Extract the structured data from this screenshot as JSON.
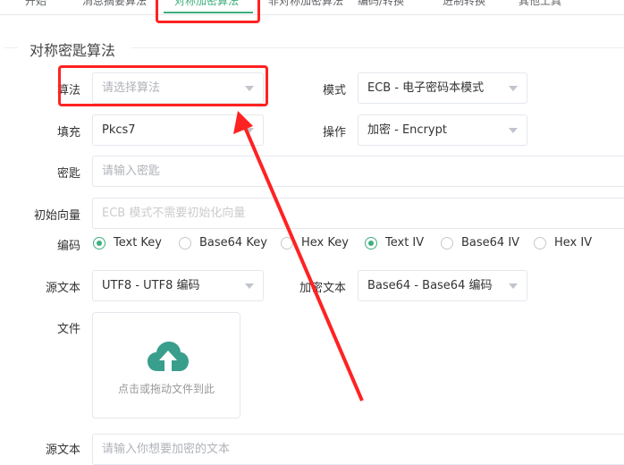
{
  "tabs": [
    {
      "label": "开始"
    },
    {
      "label": "消息摘要算法"
    },
    {
      "label": "对称加密算法",
      "active": true
    },
    {
      "label": "非对称加密算法"
    },
    {
      "label": "编码/转换"
    },
    {
      "label": "进制转换"
    },
    {
      "label": "其他工具"
    }
  ],
  "section_title": "对称密匙算法",
  "form": {
    "algorithm": {
      "label": "算法",
      "placeholder": "请选择算法"
    },
    "mode": {
      "label": "模式",
      "value": "ECB - 电子密码本模式"
    },
    "padding": {
      "label": "填充",
      "value": "Pkcs7"
    },
    "operation": {
      "label": "操作",
      "value": "加密 - Encrypt"
    },
    "key": {
      "label": "密匙",
      "placeholder": "请输入密匙"
    },
    "iv": {
      "label": "初始向量",
      "placeholder": "ECB 模式不需要初始化向量"
    },
    "encoding": {
      "label": "编码",
      "options": [
        {
          "label": "Text Key",
          "checked": true
        },
        {
          "label": "Base64 Key",
          "checked": false
        },
        {
          "label": "Hex Key",
          "checked": false
        },
        {
          "label": "Text IV",
          "checked": true
        },
        {
          "label": "Base64 IV",
          "checked": false
        },
        {
          "label": "Hex IV",
          "checked": false
        }
      ]
    },
    "source_encoding": {
      "label": "源文本",
      "value": "UTF8 - UTF8 编码"
    },
    "cipher_encoding": {
      "label": "加密文本",
      "value": "Base64 - Base64 编码"
    },
    "file": {
      "label": "文件",
      "upload_text": "点击或拖动文件到此"
    },
    "source_text": {
      "label": "源文本",
      "placeholder": "请输入你想要加密的文本"
    }
  },
  "colors": {
    "accent": "#3eaf7c",
    "annotation": "#ff2222"
  }
}
